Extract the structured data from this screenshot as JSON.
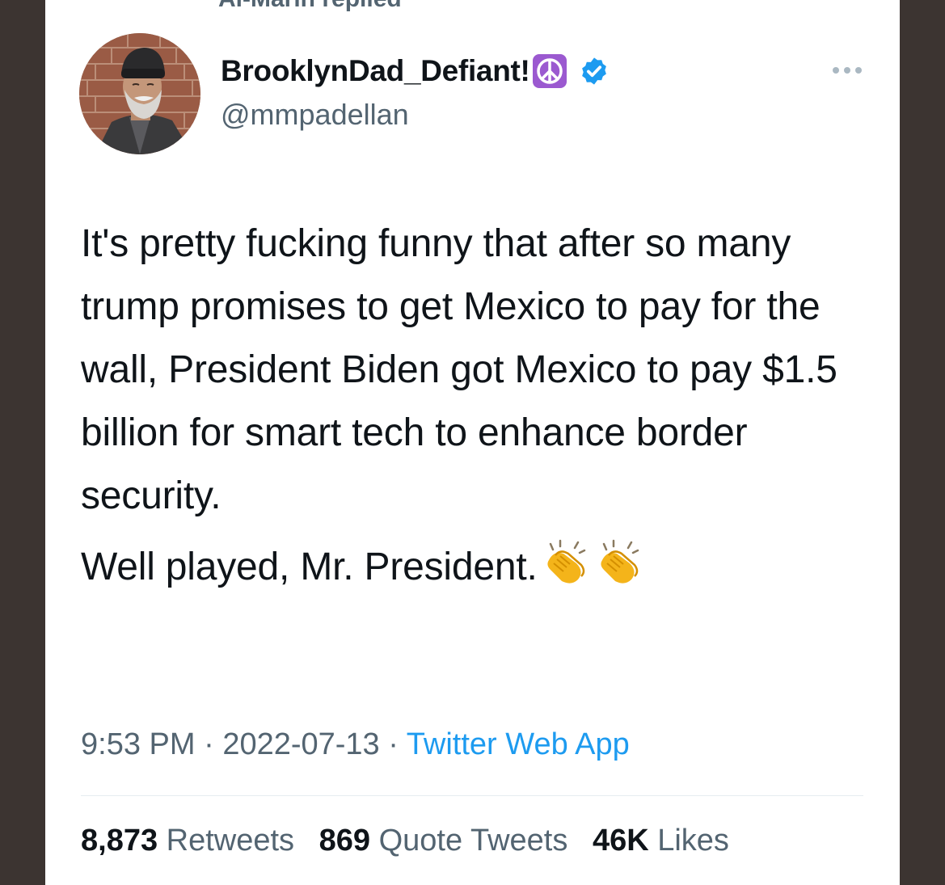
{
  "context": {
    "text": "Al-Marin replied"
  },
  "author": {
    "display_name": "BrooklynDad_Defiant!",
    "handle": "@mmpadellan",
    "name_emoji": "peace-symbol",
    "verified": true
  },
  "tweet": {
    "paragraph_1": "It's pretty fucking funny that after so many trump promises to get Mexico to pay for the wall, President Biden got Mexico to pay $1.5 billion for smart tech to enhance border security.",
    "paragraph_2": "Well played, Mr. President.",
    "trailing_emoji": [
      "clapping-hands",
      "clapping-hands"
    ]
  },
  "meta": {
    "time": "9:53 PM",
    "separator": "·",
    "date": "2022-07-13",
    "source": "Twitter Web App"
  },
  "stats": {
    "retweets_count": "8,873",
    "retweets_label": "Retweets",
    "quotes_count": "869",
    "quotes_label": "Quote Tweets",
    "likes_count": "46K",
    "likes_label": "Likes"
  },
  "colors": {
    "background": "#3c3431",
    "card": "#ffffff",
    "text_primary": "#0f1419",
    "text_secondary": "#536471",
    "link": "#1d9bf0",
    "verified_badge": "#1d9bf0",
    "peace_emoji_bg": "#9b59d0"
  }
}
